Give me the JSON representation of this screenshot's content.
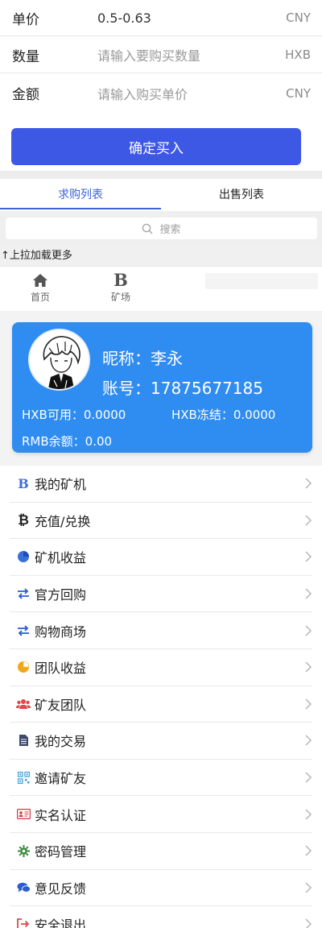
{
  "buy_form": {
    "price_label": "单价",
    "price_value": "0.5-0.63",
    "price_unit": "CNY",
    "qty_label": "数量",
    "qty_placeholder": "请输入要购买数量",
    "qty_unit": "HXB",
    "amount_label": "金额",
    "amount_placeholder": "请输入购买单价",
    "amount_unit": "CNY",
    "confirm_label": "确定买入"
  },
  "tabs": [
    {
      "label": "求购列表",
      "active": true
    },
    {
      "label": "出售列表",
      "active": false
    }
  ],
  "search": {
    "placeholder": "搜索"
  },
  "pull_more": "↑上拉加载更多",
  "mini_nav": [
    {
      "label": "首页",
      "icon": "home-icon"
    },
    {
      "label": "矿场",
      "icon": "bee-icon"
    }
  ],
  "profile": {
    "nickname": "昵称：李永",
    "account": "账号：17875677185",
    "hxb_available": "HXB可用：0.0000",
    "hxb_frozen": "HXB冻结：0.0000",
    "rmb_balance": "RMB余额：0.00"
  },
  "colors": {
    "accent": "#3b63d8",
    "button": "#3e58e6",
    "card": "#2f8cf0"
  },
  "menu": [
    {
      "label": "我的矿机",
      "icon": "bee-letter-icon"
    },
    {
      "label": "充值/兑换",
      "icon": "bitcoin-icon"
    },
    {
      "label": "矿机收益",
      "icon": "pie-chart-icon"
    },
    {
      "label": "官方回购",
      "icon": "exchange-icon"
    },
    {
      "label": "购物商场",
      "icon": "exchange-icon"
    },
    {
      "label": "团队收益",
      "icon": "pie-chart-icon"
    },
    {
      "label": "矿友团队",
      "icon": "users-icon"
    },
    {
      "label": "我的交易",
      "icon": "document-icon"
    },
    {
      "label": "邀请矿友",
      "icon": "qrcode-icon"
    },
    {
      "label": "实名认证",
      "icon": "id-card-icon"
    },
    {
      "label": "密码管理",
      "icon": "gear-icon"
    },
    {
      "label": "意见反馈",
      "icon": "chat-icon"
    },
    {
      "label": "安全退出",
      "icon": "logout-icon"
    }
  ]
}
